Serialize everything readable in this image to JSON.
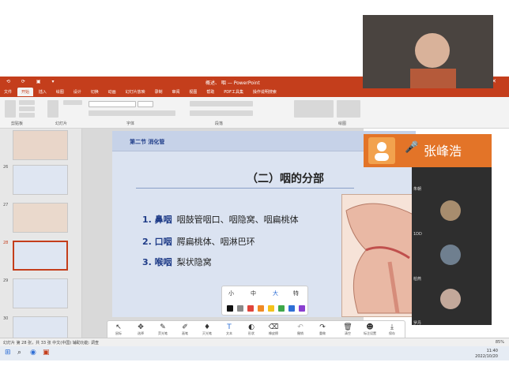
{
  "window": {
    "title": "概述、   咽 — PowerPoint",
    "win_controls": "—  ☐  ✕",
    "quick_access": "⟲ ⟳ ▣ ▾"
  },
  "tabs": [
    "文件",
    "开始",
    "插入",
    "绘图",
    "设计",
    "切换",
    "动画",
    "幻灯片放映",
    "录制",
    "审阅",
    "视图",
    "帮助",
    "PDF工具集",
    "操作说明搜索"
  ],
  "ribbon": {
    "groups": [
      "剪贴板",
      "幻灯片",
      "字体",
      "段落",
      "绘图"
    ]
  },
  "thumbnails": {
    "numbers": [
      "26",
      "27",
      "28",
      "29",
      "30"
    ],
    "selected": "28"
  },
  "slide": {
    "section": "第二节 消化管",
    "title": "（二）咽的分部",
    "items": [
      {
        "num": "1. 鼻咽",
        "text": "咽鼓管咽口、咽隐窝、咽扁桃体"
      },
      {
        "num": "2. 口咽",
        "text": "腭扁桃体、咽淋巴环"
      },
      {
        "num": "3. 喉咽",
        "text": "梨状隐窝"
      }
    ]
  },
  "speaker": {
    "name": "张峰浩",
    "mic": "🎤"
  },
  "participants": [
    "朱朝",
    "1DD",
    "柏燕",
    "罗丹"
  ],
  "palette": {
    "sizes": [
      "小",
      "中",
      "大",
      "特"
    ],
    "colors": [
      "#111111",
      "#8a8a8a",
      "#e0443b",
      "#f08a24",
      "#f4c21b",
      "#3ea84a",
      "#2f6fd6",
      "#8a3fd0"
    ]
  },
  "toolbar": [
    {
      "g": "↖",
      "l": "鼠标"
    },
    {
      "g": "✥",
      "l": "选择"
    },
    {
      "g": "✎",
      "l": "荧光笔"
    },
    {
      "g": "✐",
      "l": "画笔"
    },
    {
      "g": "♦",
      "l": "灭光笔"
    },
    {
      "g": "T",
      "l": "文本"
    },
    {
      "g": "◐",
      "l": "形状"
    },
    {
      "g": "⌫",
      "l": "橡皮擦"
    },
    {
      "g": "↶",
      "l": "撤销"
    },
    {
      "g": "↷",
      "l": "重做"
    },
    {
      "g": "🗑",
      "l": "清空"
    },
    {
      "g": "☻",
      "l": "标注设置"
    },
    {
      "g": "⤓",
      "l": "保存"
    }
  ],
  "status": {
    "left": "幻灯片 第 28 张，共 33 张   中文(中国)   辅助功能: 调查",
    "right": "85%"
  },
  "clock": {
    "time": "11:40",
    "date": "2022/10/20"
  }
}
